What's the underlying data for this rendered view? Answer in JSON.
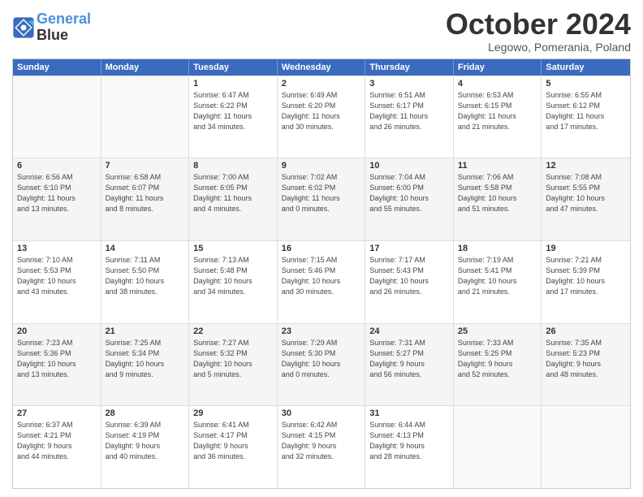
{
  "header": {
    "logo_line1": "General",
    "logo_line2": "Blue",
    "month_title": "October 2024",
    "subtitle": "Legowo, Pomerania, Poland"
  },
  "days_of_week": [
    "Sunday",
    "Monday",
    "Tuesday",
    "Wednesday",
    "Thursday",
    "Friday",
    "Saturday"
  ],
  "rows": [
    [
      {
        "day": "",
        "info": ""
      },
      {
        "day": "",
        "info": ""
      },
      {
        "day": "1",
        "info": "Sunrise: 6:47 AM\nSunset: 6:22 PM\nDaylight: 11 hours\nand 34 minutes."
      },
      {
        "day": "2",
        "info": "Sunrise: 6:49 AM\nSunset: 6:20 PM\nDaylight: 11 hours\nand 30 minutes."
      },
      {
        "day": "3",
        "info": "Sunrise: 6:51 AM\nSunset: 6:17 PM\nDaylight: 11 hours\nand 26 minutes."
      },
      {
        "day": "4",
        "info": "Sunrise: 6:53 AM\nSunset: 6:15 PM\nDaylight: 11 hours\nand 21 minutes."
      },
      {
        "day": "5",
        "info": "Sunrise: 6:55 AM\nSunset: 6:12 PM\nDaylight: 11 hours\nand 17 minutes."
      }
    ],
    [
      {
        "day": "6",
        "info": "Sunrise: 6:56 AM\nSunset: 6:10 PM\nDaylight: 11 hours\nand 13 minutes."
      },
      {
        "day": "7",
        "info": "Sunrise: 6:58 AM\nSunset: 6:07 PM\nDaylight: 11 hours\nand 8 minutes."
      },
      {
        "day": "8",
        "info": "Sunrise: 7:00 AM\nSunset: 6:05 PM\nDaylight: 11 hours\nand 4 minutes."
      },
      {
        "day": "9",
        "info": "Sunrise: 7:02 AM\nSunset: 6:02 PM\nDaylight: 11 hours\nand 0 minutes."
      },
      {
        "day": "10",
        "info": "Sunrise: 7:04 AM\nSunset: 6:00 PM\nDaylight: 10 hours\nand 55 minutes."
      },
      {
        "day": "11",
        "info": "Sunrise: 7:06 AM\nSunset: 5:58 PM\nDaylight: 10 hours\nand 51 minutes."
      },
      {
        "day": "12",
        "info": "Sunrise: 7:08 AM\nSunset: 5:55 PM\nDaylight: 10 hours\nand 47 minutes."
      }
    ],
    [
      {
        "day": "13",
        "info": "Sunrise: 7:10 AM\nSunset: 5:53 PM\nDaylight: 10 hours\nand 43 minutes."
      },
      {
        "day": "14",
        "info": "Sunrise: 7:11 AM\nSunset: 5:50 PM\nDaylight: 10 hours\nand 38 minutes."
      },
      {
        "day": "15",
        "info": "Sunrise: 7:13 AM\nSunset: 5:48 PM\nDaylight: 10 hours\nand 34 minutes."
      },
      {
        "day": "16",
        "info": "Sunrise: 7:15 AM\nSunset: 5:46 PM\nDaylight: 10 hours\nand 30 minutes."
      },
      {
        "day": "17",
        "info": "Sunrise: 7:17 AM\nSunset: 5:43 PM\nDaylight: 10 hours\nand 26 minutes."
      },
      {
        "day": "18",
        "info": "Sunrise: 7:19 AM\nSunset: 5:41 PM\nDaylight: 10 hours\nand 21 minutes."
      },
      {
        "day": "19",
        "info": "Sunrise: 7:21 AM\nSunset: 5:39 PM\nDaylight: 10 hours\nand 17 minutes."
      }
    ],
    [
      {
        "day": "20",
        "info": "Sunrise: 7:23 AM\nSunset: 5:36 PM\nDaylight: 10 hours\nand 13 minutes."
      },
      {
        "day": "21",
        "info": "Sunrise: 7:25 AM\nSunset: 5:34 PM\nDaylight: 10 hours\nand 9 minutes."
      },
      {
        "day": "22",
        "info": "Sunrise: 7:27 AM\nSunset: 5:32 PM\nDaylight: 10 hours\nand 5 minutes."
      },
      {
        "day": "23",
        "info": "Sunrise: 7:29 AM\nSunset: 5:30 PM\nDaylight: 10 hours\nand 0 minutes."
      },
      {
        "day": "24",
        "info": "Sunrise: 7:31 AM\nSunset: 5:27 PM\nDaylight: 9 hours\nand 56 minutes."
      },
      {
        "day": "25",
        "info": "Sunrise: 7:33 AM\nSunset: 5:25 PM\nDaylight: 9 hours\nand 52 minutes."
      },
      {
        "day": "26",
        "info": "Sunrise: 7:35 AM\nSunset: 5:23 PM\nDaylight: 9 hours\nand 48 minutes."
      }
    ],
    [
      {
        "day": "27",
        "info": "Sunrise: 6:37 AM\nSunset: 4:21 PM\nDaylight: 9 hours\nand 44 minutes."
      },
      {
        "day": "28",
        "info": "Sunrise: 6:39 AM\nSunset: 4:19 PM\nDaylight: 9 hours\nand 40 minutes."
      },
      {
        "day": "29",
        "info": "Sunrise: 6:41 AM\nSunset: 4:17 PM\nDaylight: 9 hours\nand 36 minutes."
      },
      {
        "day": "30",
        "info": "Sunrise: 6:42 AM\nSunset: 4:15 PM\nDaylight: 9 hours\nand 32 minutes."
      },
      {
        "day": "31",
        "info": "Sunrise: 6:44 AM\nSunset: 4:13 PM\nDaylight: 9 hours\nand 28 minutes."
      },
      {
        "day": "",
        "info": ""
      },
      {
        "day": "",
        "info": ""
      }
    ]
  ]
}
